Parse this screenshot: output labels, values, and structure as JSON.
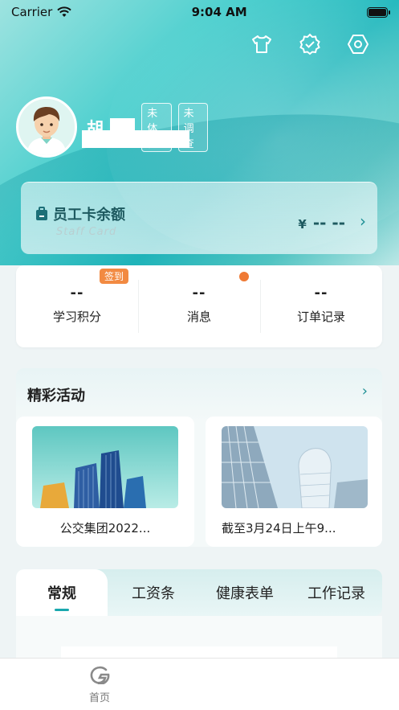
{
  "status": {
    "carrier": "Carrier",
    "time": "9:04 AM"
  },
  "header_icons": [
    "shirt-icon",
    "verified-icon",
    "settings-icon"
  ],
  "profile": {
    "name": "胡",
    "tags": [
      "未体检",
      "未调查"
    ]
  },
  "balance": {
    "title": "员工卡余额",
    "subtitle": "Staff Card",
    "currency": "¥",
    "amount": "-- --"
  },
  "stats": [
    {
      "value": "--",
      "label": "学习积分",
      "badge": "签到"
    },
    {
      "value": "--",
      "label": "消息"
    },
    {
      "value": "--",
      "label": "订单记录"
    }
  ],
  "activities": {
    "title": "精彩活动",
    "items": [
      {
        "caption": "公交集团2022..."
      },
      {
        "caption": "截至3月24日上午9..."
      }
    ]
  },
  "tabs": [
    "常规",
    "工资条",
    "健康表单",
    "工作记录"
  ],
  "tabbar": {
    "home_label": "首页"
  },
  "colors": {
    "accent": "#1aa8ae",
    "badge": "#f28a42"
  }
}
